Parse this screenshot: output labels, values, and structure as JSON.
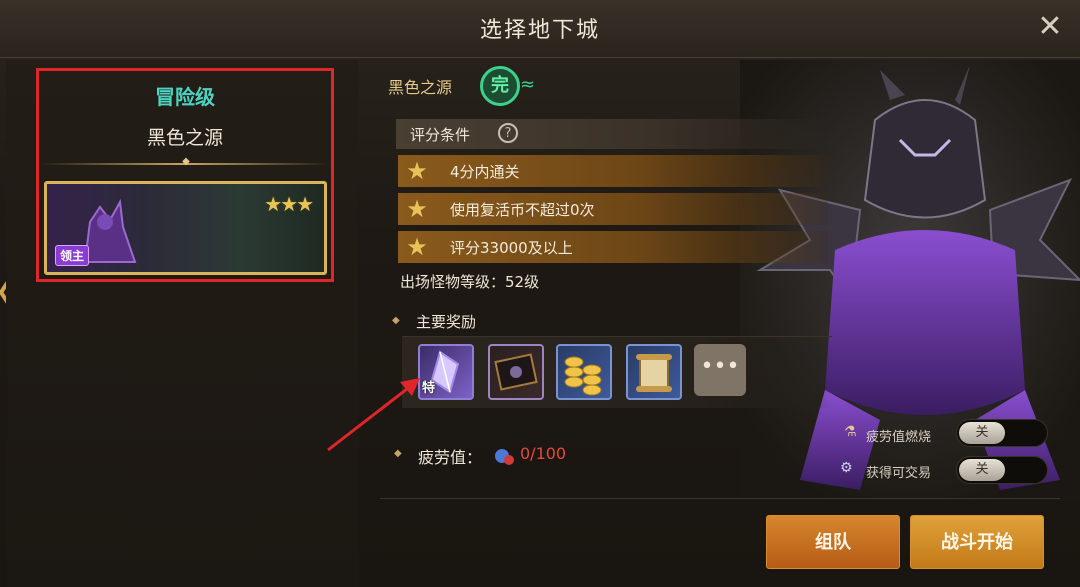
{
  "window": {
    "title": "选择地下城",
    "close_label": "✕"
  },
  "nav": {
    "left_arrow": "❯",
    "right_arrow": "❯"
  },
  "dungeon_card": {
    "level": "冒险级",
    "name": "黑色之源",
    "stars": "★★★",
    "badge": "领主"
  },
  "details": {
    "dungeon_name": "黑色之源",
    "complete_badge": "完",
    "score_conditions_label": "评分条件",
    "help_label": "?",
    "conditions": [
      {
        "text": "4分内通关"
      },
      {
        "text": "使用复活币不超过0次"
      },
      {
        "text": "评分33000及以上"
      }
    ],
    "monster_level": "出场怪物等级：52级",
    "rewards_label": "主要奖励",
    "rewards": [
      {
        "icon": "crystal-icon",
        "tag": "特"
      },
      {
        "icon": "card-icon",
        "tag": ""
      },
      {
        "icon": "gold-coins-icon",
        "tag": ""
      },
      {
        "icon": "scroll-icon",
        "tag": ""
      }
    ],
    "more_label": "•••",
    "fatigue_label": "疲劳值：",
    "fatigue_value": "0/100"
  },
  "toggles": [
    {
      "label": "疲劳值燃烧",
      "state": "关",
      "icon": "potion-icon"
    },
    {
      "label": "获得可交易",
      "state": "关",
      "icon": "trade-icon"
    }
  ],
  "buttons": {
    "team": "组队",
    "start": "战斗开始"
  },
  "colors": {
    "accent_orange": "#c27a18",
    "level_teal": "#4bd4c1",
    "highlight_red": "#e0262a",
    "fatigue_red": "#e14a3a"
  }
}
